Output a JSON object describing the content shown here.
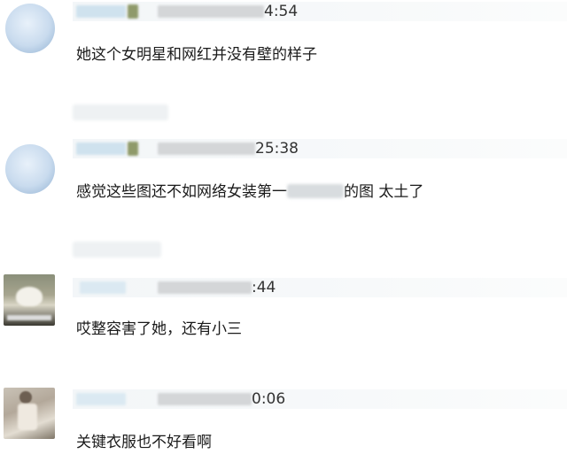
{
  "comments": [
    {
      "time_suffix": "4:54",
      "text": "她这个女明星和网红并没有壁的样子",
      "text_after_mask": ""
    },
    {
      "time_suffix": "25:38",
      "text": "感觉这些图还不如网络女装第一",
      "text_after_mask": "的图 太土了"
    },
    {
      "time_suffix": ":44",
      "text": "哎整容害了她，还有小三",
      "text_after_mask": ""
    },
    {
      "time_suffix": "0:06",
      "text": "关键衣服也不好看啊",
      "text_after_mask": ""
    }
  ],
  "icons": {
    "avatar_1": "user-avatar-icon",
    "avatar_2": "user-avatar-icon",
    "avatar_3": "user-photo-avatar",
    "avatar_4": "user-photo-avatar"
  }
}
